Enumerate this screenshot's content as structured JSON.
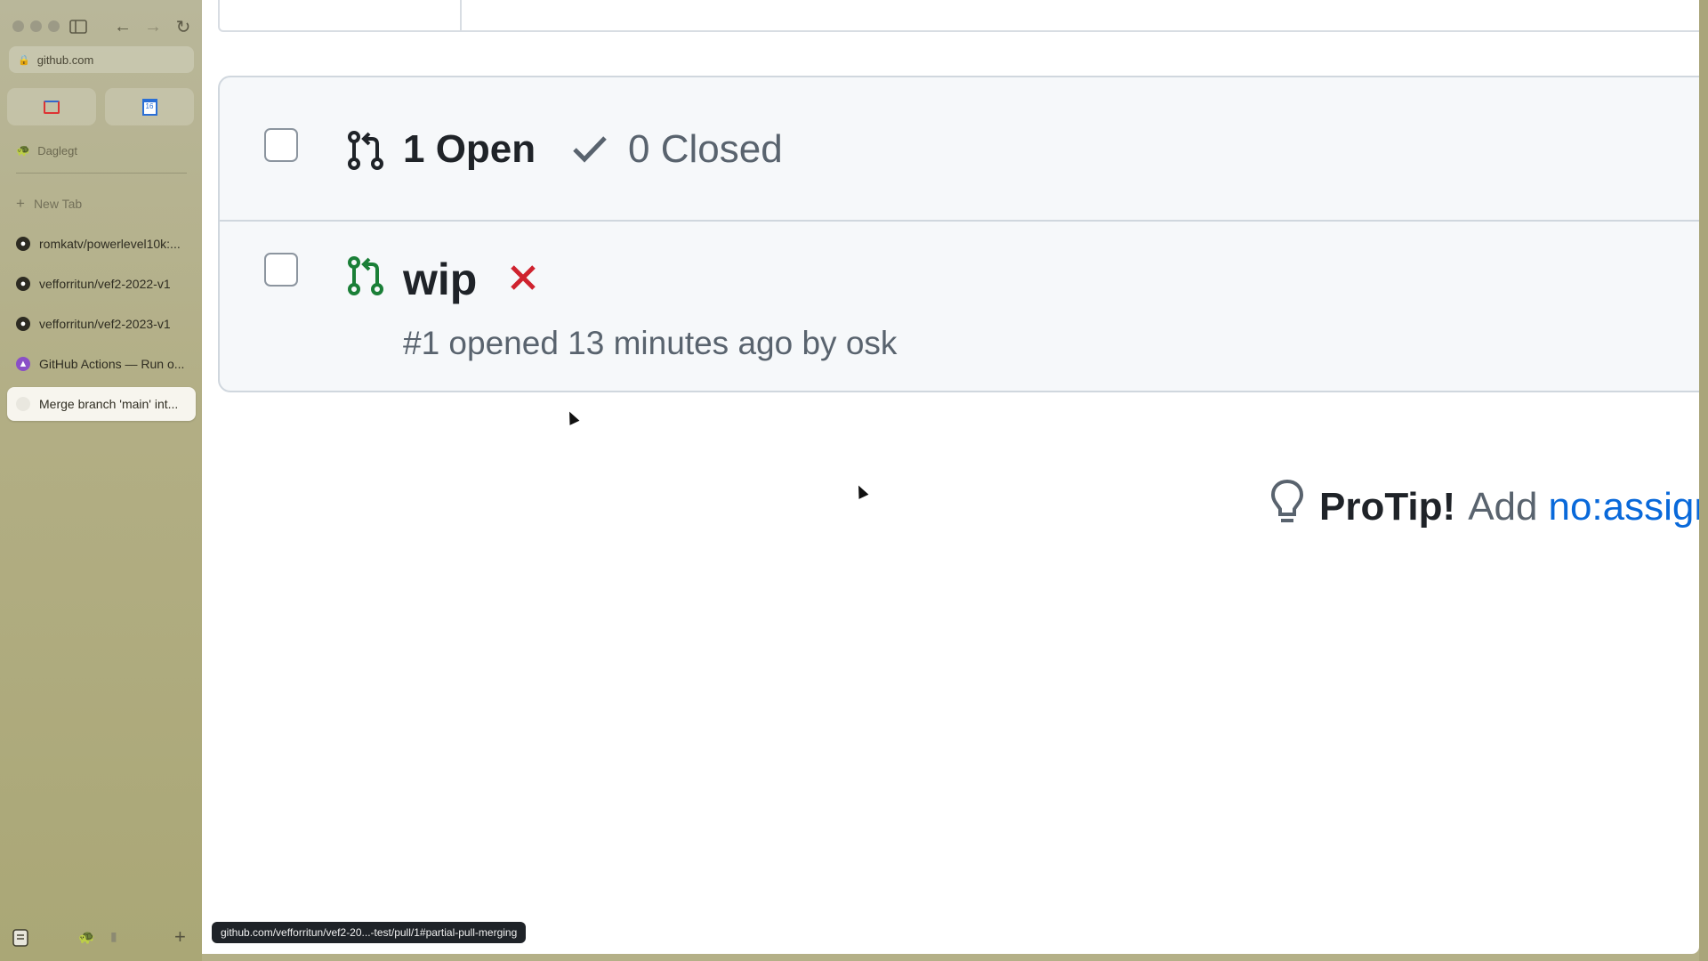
{
  "browser": {
    "url": "github.com",
    "space_name": "Daglegt",
    "new_tab_label": "New Tab",
    "status_link": "github.com/vefforritun/vef2-20...-test/pull/1#partial-pull-merging"
  },
  "tabs": [
    {
      "label": "romkatv/powerlevel10k:...",
      "icon": "github-icon"
    },
    {
      "label": "vefforritun/vef2-2022-v1",
      "icon": "github-icon"
    },
    {
      "label": "vefforritun/vef2-2023-v1",
      "icon": "github-icon"
    },
    {
      "label": "GitHub Actions — Run o...",
      "icon": "github-actions-icon"
    },
    {
      "label": "Merge branch 'main' int...",
      "icon": "page-icon",
      "active": true
    }
  ],
  "favorites": [
    {
      "icon": "gmail-icon"
    },
    {
      "icon": "calendar-icon",
      "text": "16"
    }
  ],
  "pulls": {
    "open_label": "1 Open",
    "closed_label": "0 Closed",
    "items": [
      {
        "title": "wip",
        "status_icon": "x-icon",
        "meta": "#1 opened 13 minutes ago by osk"
      }
    ]
  },
  "protip": {
    "strong": "ProTip!",
    "text": "Add",
    "link": "no:assign"
  },
  "colors": {
    "open_icon": "#1f2328",
    "pr_icon_green": "#1a7f37",
    "fail_red": "#cf222e",
    "link_blue": "#0969da"
  }
}
